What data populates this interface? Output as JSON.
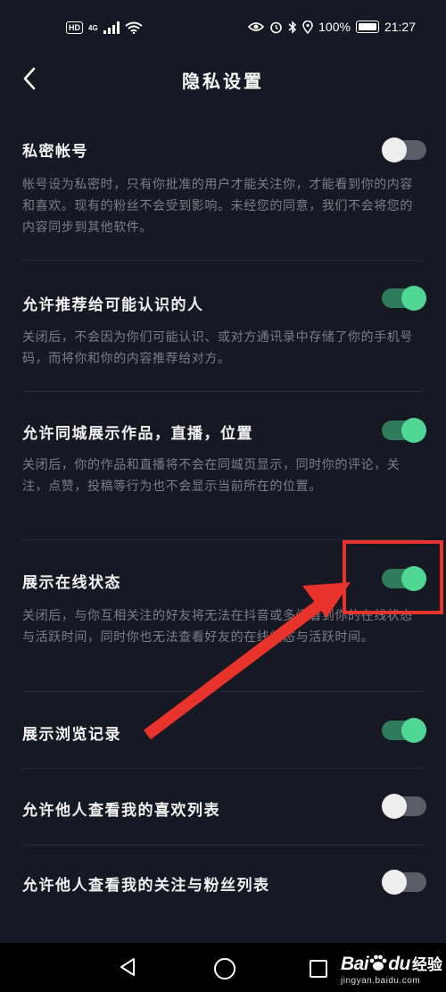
{
  "status_bar": {
    "hd": "HD",
    "network": "4G",
    "battery": "100%",
    "time": "21:27"
  },
  "header": {
    "title": "隐私设置"
  },
  "settings": [
    {
      "title": "私密帐号",
      "description": "帐号设为私密时，只有你批准的用户才能关注你，才能看到你的内容和喜欢。现有的粉丝不会受到影响。未经您的同意，我们不会将您的内容同步到其他软件。",
      "enabled": false
    },
    {
      "title": "允许推荐给可能认识的人",
      "description": "关闭后，不会因为你们可能认识、或对方通讯录中存储了你的手机号码，而将你和你的内容推荐给对方。",
      "enabled": true
    },
    {
      "title": "允许同城展示作品，直播，位置",
      "description": "关闭后，你的作品和直播将不会在同城页显示，同时你的评论，关注，点赞，投稿等行为也不会显示当前所在的位置。",
      "enabled": true
    },
    {
      "title": "展示在线状态",
      "description": "关闭后，与你互相关注的好友将无法在抖音或多闪看到你的在线状态与活跃时间，同时你也无法查看好友的在线状态与活跃时间。",
      "enabled": true
    },
    {
      "title": "展示浏览记录",
      "enabled": true
    },
    {
      "title": "允许他人查看我的喜欢列表",
      "enabled": false
    },
    {
      "title": "允许他人查看我的关注与粉丝列表",
      "enabled": false
    }
  ],
  "watermark": {
    "logo": "Bai",
    "logo_suffix": "du",
    "text": "经验",
    "url": "jingyan.baidu.com"
  },
  "colors": {
    "background": "#161823",
    "toggle_on": "#4fd793",
    "toggle_off": "#eeeeee",
    "annotation": "#e8322c"
  }
}
